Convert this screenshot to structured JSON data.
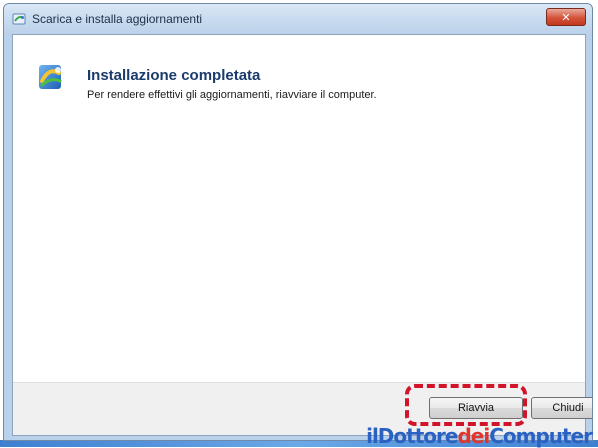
{
  "window": {
    "title": "Scarica e installa aggiornamenti",
    "close_label": "✕"
  },
  "status": {
    "heading": "Installazione completata",
    "message": "Per rendere effettivi gli aggiornamenti, riavviare il computer."
  },
  "buttons": {
    "restart_label": "Riavvia",
    "close_label": "Chiudi"
  },
  "watermark": {
    "part1": "ilDottore",
    "part2": "dei",
    "part3": "Computer"
  },
  "colors": {
    "heading": "#1a3b6c",
    "highlight": "#d2142a"
  },
  "icons": {
    "title_icon": "windows-update-icon",
    "status_icon": "windows-update-icon"
  }
}
